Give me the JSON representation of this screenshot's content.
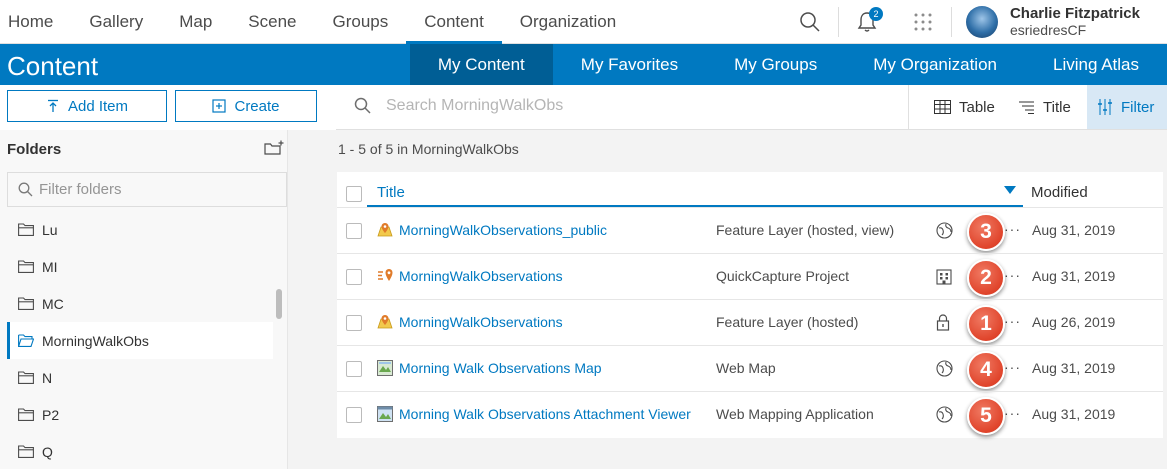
{
  "topnav": {
    "items": [
      "Home",
      "Gallery",
      "Map",
      "Scene",
      "Groups",
      "Content",
      "Organization"
    ],
    "active": "Content",
    "notification_count": "2",
    "user_name": "Charlie Fitzpatrick",
    "user_id": "esriedresCF"
  },
  "content_bar": {
    "title": "Content",
    "tabs": [
      "My Content",
      "My Favorites",
      "My Groups",
      "My Organization",
      "Living Atlas"
    ],
    "active_tab": "My Content"
  },
  "actions": {
    "add_item": "Add Item",
    "create": "Create"
  },
  "search": {
    "placeholder": "Search MorningWalkObs"
  },
  "toolbar": {
    "table": "Table",
    "title": "Title",
    "filter": "Filter"
  },
  "folders": {
    "heading": "Folders",
    "filter_placeholder": "Filter folders",
    "items": [
      "Lu",
      "MI",
      "MC",
      "MorningWalkObs",
      "N",
      "P2",
      "Q"
    ],
    "active": "MorningWalkObs"
  },
  "results": {
    "count_text": "1 - 5 of 5 in MorningWalkObs"
  },
  "table": {
    "headers": {
      "title": "Title",
      "modified": "Modified"
    },
    "rows": [
      {
        "title": "MorningWalkObservations_public",
        "type": "Feature Layer (hosted, view)",
        "icon": "feature-layer-icon",
        "share": "public-icon",
        "modified": "Aug 31, 2019",
        "marker": "3"
      },
      {
        "title": "MorningWalkObservations",
        "type": "QuickCapture Project",
        "icon": "quickcapture-icon",
        "share": "organization-icon",
        "modified": "Aug 31, 2019",
        "marker": "2"
      },
      {
        "title": "MorningWalkObservations",
        "type": "Feature Layer (hosted)",
        "icon": "feature-layer-icon",
        "share": "lock-icon",
        "modified": "Aug 26, 2019",
        "marker": "1"
      },
      {
        "title": "Morning Walk Observations Map",
        "type": "Web Map",
        "icon": "web-map-icon",
        "share": "public-icon",
        "modified": "Aug 31, 2019",
        "marker": "4"
      },
      {
        "title": "Morning Walk Observations Attachment Viewer",
        "type": "Web Mapping Application",
        "icon": "web-app-icon",
        "share": "public-icon",
        "modified": "Aug 31, 2019",
        "marker": "5"
      }
    ]
  },
  "colors": {
    "brand_blue": "#0079c1",
    "active_tab": "#005e95",
    "marker_red": "#e0442b"
  }
}
